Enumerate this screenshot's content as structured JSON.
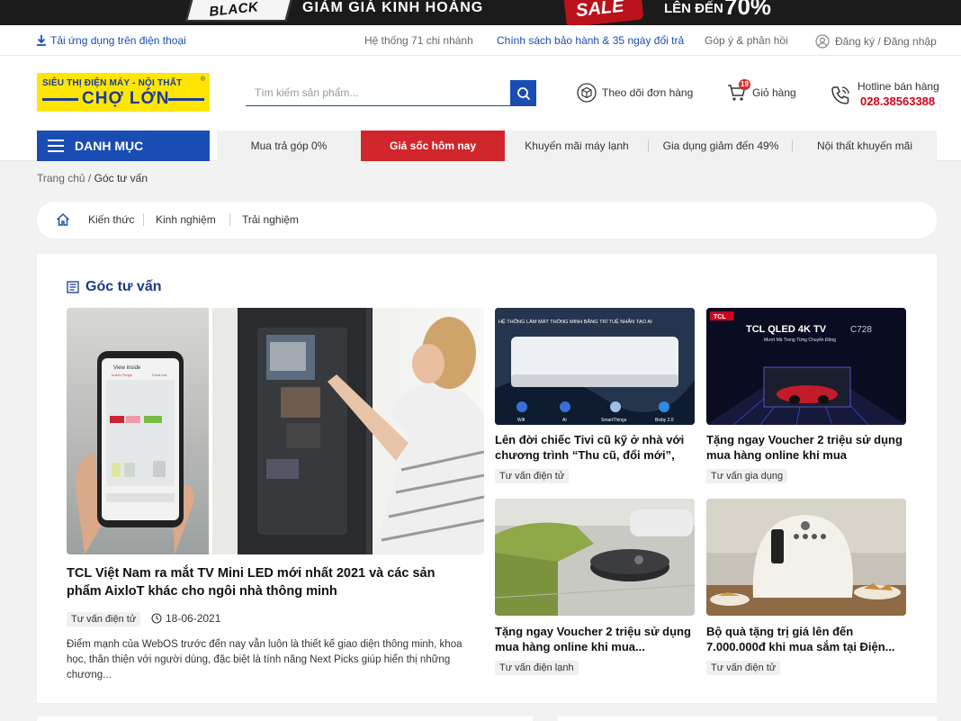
{
  "promo": {
    "black_friday": "BLACK FRIDAY",
    "headline": "GIẢM GIÁ KINH HOÀNG",
    "sale": "SALE",
    "upto": "LÊN ĐẾN",
    "percent": "70%"
  },
  "topbar": {
    "app_download": "Tải ứng dụng trên điện thoại",
    "branches": "Hệ thống 71 chi nhánh",
    "warranty_policy": "Chính sách bảo hành & 35 ngày đổi trả",
    "feedback": "Góp ý & phản hồi",
    "auth": "Đăng ký / Đăng nhập"
  },
  "header": {
    "logo_line1": "SIÊU THỊ ĐIỆN MÁY - NỘI THẤT",
    "logo_line2": "CHỢ LỚN",
    "logo_reg": "®",
    "search_placeholder": "Tìm kiếm sản phẩm...",
    "track_order": "Theo dõi đơn hàng",
    "cart_label": "Giỏ hàng",
    "cart_count": "19",
    "hotline_label": "Hotline bán hàng",
    "hotline_number": "028.38563388"
  },
  "nav": {
    "menu_label": "DANH MỤC",
    "items": [
      {
        "label": "Mua trả góp 0%",
        "active": false
      },
      {
        "label": "Giá sốc hôm nay",
        "active": true
      },
      {
        "label": "Khuyến mãi máy lạnh",
        "active": false
      },
      {
        "label": "Gia dụng giảm đến 49%",
        "active": false
      },
      {
        "label": "Nội thất khuyến mãi",
        "active": false
      }
    ]
  },
  "breadcrumb": {
    "home": "Trang chủ",
    "separator": " / ",
    "current": "Góc tư vấn"
  },
  "subnav": {
    "items": [
      "Kiến thức",
      "Kinh nghiệm",
      "Trải nghiệm"
    ]
  },
  "section": {
    "title": "Góc tư vấn"
  },
  "featured": {
    "title": "TCL Việt Nam ra mắt TV Mini LED mới nhất 2021 và các sản phẩm AixloT khác cho ngôi nhà thông minh",
    "tag": "Tư vấn điện tử",
    "date": "18-06-2021",
    "description": "Điểm mạnh của WebOS trước đến nay vẫn luôn là thiết kế giao diện thông minh, khoa học, thân thiện với người dùng, đặc biệt là tính năng Next Picks giúp hiển thị những chương..."
  },
  "cards": [
    {
      "title": "Lên đời chiếc Tivi cũ kỹ ở nhà với chương trình “Thu cũ, đổi mới”,",
      "tag": "Tư vấn điện tử",
      "image_caption": "HỆ THỐNG LÀM MÁT THÔNG MINH BẰNG TRÍ TUỆ NHÂN TẠO AI",
      "image_labels": [
        "Wifi",
        "AI",
        "SmartThings",
        "Bixby 2.0"
      ]
    },
    {
      "title": "Tặng ngay Voucher 2 triệu sử dụng mua hàng online khi mua",
      "tag": "Tư vấn gia dụng",
      "image_brand": "TCL",
      "image_caption": "TCL QLED 4K TV",
      "image_model": "C728",
      "image_sub": "Mượt Mà Trong Từng Chuyển Động"
    },
    {
      "title": "Tặng ngay Voucher 2 triệu sử dụng mua hàng online khi mua...",
      "tag": "Tư vấn điện lạnh"
    },
    {
      "title": "Bộ quà tặng trị giá lên đến 7.000.000đ khi mua sắm tại Điện...",
      "tag": "Tư vấn điện tử"
    }
  ],
  "featured_image": {
    "phone_header": "View inside",
    "phone_tab1": "Inside Fridge",
    "phone_tab2": "Food List"
  },
  "colors": {
    "brand_blue": "#1a4db3",
    "brand_yellow": "#ffe600",
    "hot_red": "#d0262b",
    "hotline_red": "#d0021b"
  }
}
